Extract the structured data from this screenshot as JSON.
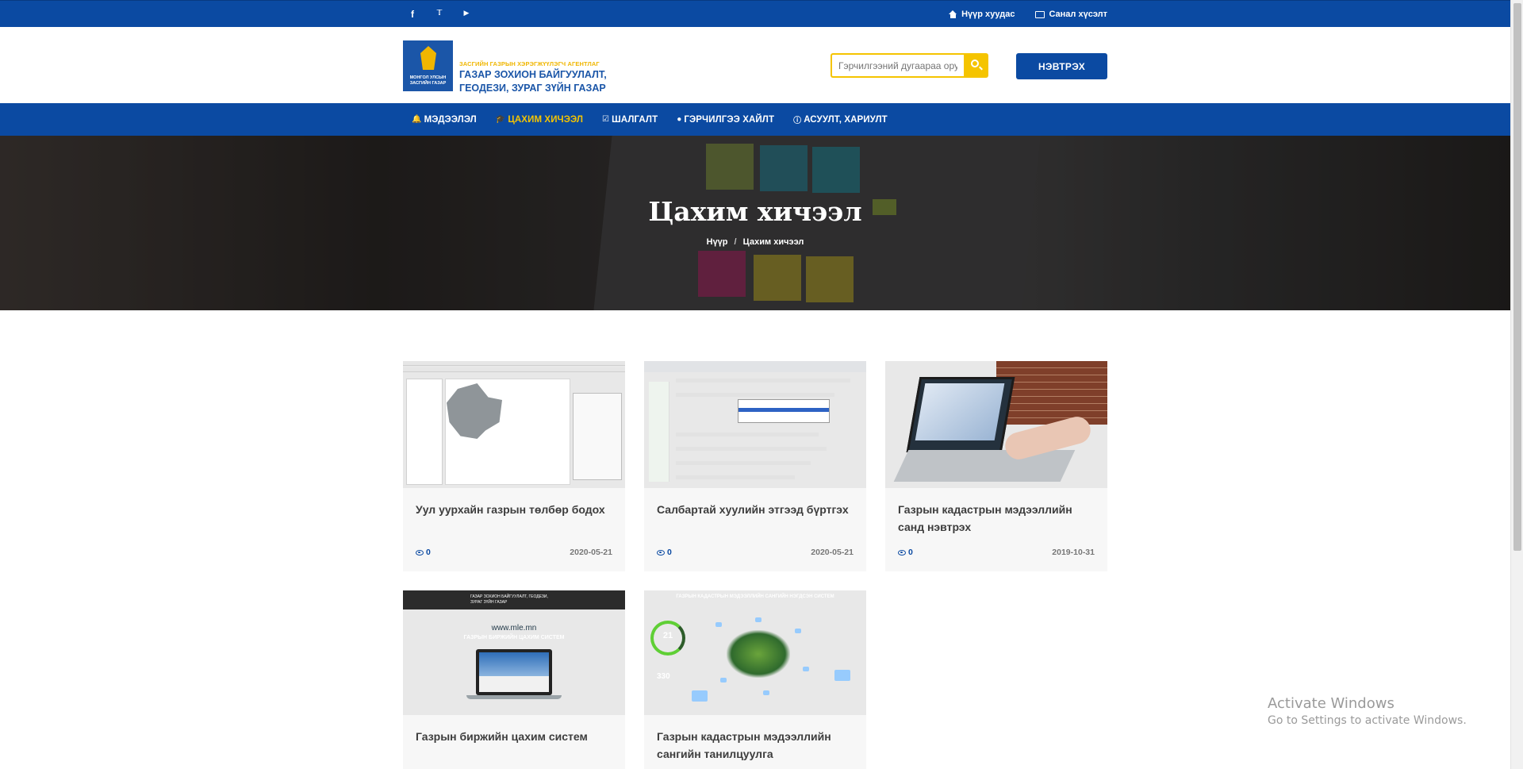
{
  "topbar": {
    "social": [
      {
        "icon": "facebook-icon",
        "glyph": "f"
      },
      {
        "icon": "twitter-icon",
        "glyph": "🐦"
      },
      {
        "icon": "youtube-icon",
        "glyph": "▶"
      }
    ],
    "home_label": "Нүүр хуудас",
    "feedback_label": "Санал хүсэлт"
  },
  "header": {
    "logo_emblem_text": "МОНГОЛ УЛСЫН ЗАСГИЙН ГАЗАР",
    "logo_line1": "ЗАСГИЙН ГАЗРЫН ХЭРЭГЖҮҮЛЭГЧ АГЕНТЛАГ",
    "logo_line2": "ГАЗАР ЗОХИОН БАЙГУУЛАЛТ,",
    "logo_line3": "ГЕОДЕЗИ, ЗУРАГ ЗҮЙН ГАЗАР",
    "search_placeholder": "Гэрчилгээний дугаараа оруулна уу",
    "login_label": "НЭВТРЭХ"
  },
  "nav": {
    "items": [
      {
        "label": "МЭДЭЭЛЭЛ",
        "icon": "bell-icon",
        "glyph": "🔔",
        "active": false
      },
      {
        "label": "ЦАХИМ ХИЧЭЭЛ",
        "icon": "graduation-cap-icon",
        "glyph": "🎓",
        "active": true
      },
      {
        "label": "ШАЛГАЛТ",
        "icon": "check-square-icon",
        "glyph": "☑",
        "active": false
      },
      {
        "label": "ГЭРЧИЛГЭЭ ХАЙЛТ",
        "icon": "circle-icon",
        "glyph": "●",
        "active": false
      },
      {
        "label": "АСУУЛТ, ХАРИУЛТ",
        "icon": "info-icon",
        "glyph": "ℹ",
        "active": false
      }
    ]
  },
  "hero": {
    "title": "Цахим хичээл",
    "breadcrumb_home": "Нүүр",
    "breadcrumb_current": "Цахим хичээл"
  },
  "courses": [
    {
      "title": "Уул уурхайн газрын төлбөр бодох",
      "views": "0",
      "date": "2020-05-21"
    },
    {
      "title": "Салбартай хуулийн этгээд бүртгэх",
      "views": "0",
      "date": "2020-05-21"
    },
    {
      "title": "Газрын кадастрын мэдээллийн санд нэвтрэх",
      "views": "0",
      "date": "2019-10-31"
    },
    {
      "title": "Газрын биржийн цахим систем",
      "views": "",
      "date": ""
    },
    {
      "title": "Газрын кадастрын мэдээллийн сангийн танилцуулга",
      "views": "",
      "date": ""
    }
  ],
  "thumb_text": {
    "mle_url": "www.mle.mn",
    "mle_subtitle": "ГАЗРЫН БИРЖИЙН ЦАХИМ СИСТЕМ",
    "mle_logo": "ГАЗАР ЗОХИОН БАЙГУУЛАЛТ, ГЕОДЕЗИ, ЗУРАГ ЗҮЙН ГАЗАР",
    "cad_title": "ГАЗРЫН КАДАСТРЫН МЭДЭЭЛЛИЙН САНГИЙН НЭГДСЭН СИСТЕМ",
    "cad_num1": "21",
    "cad_num2": "330"
  },
  "watermark": {
    "line1": "Activate Windows",
    "line2": "Go to Settings to activate Windows."
  },
  "colors": {
    "primary": "#0b4aa2",
    "accent": "#f5c400"
  }
}
